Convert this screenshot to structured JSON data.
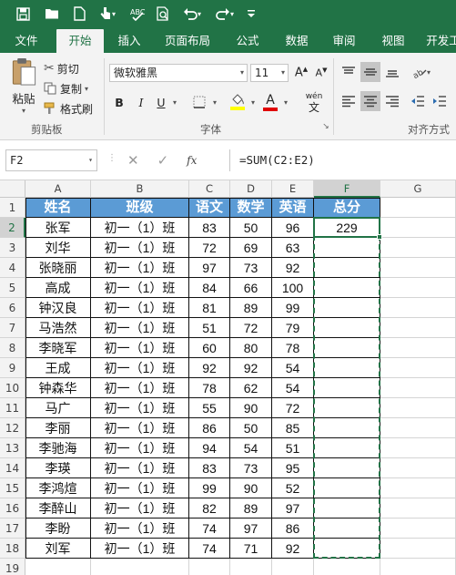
{
  "tabs": [
    "文件",
    "开始",
    "插入",
    "页面布局",
    "公式",
    "数据",
    "审阅",
    "视图",
    "开发工"
  ],
  "active_tab": "开始",
  "clipboard": {
    "paste": "粘贴",
    "cut": "剪切",
    "copy": "复制",
    "format_painter": "格式刷",
    "group_label": "剪贴板"
  },
  "font": {
    "name": "微软雅黑",
    "size": "11",
    "bold": "B",
    "italic": "I",
    "underline": "U",
    "wen": "wén",
    "wen_char": "文",
    "group_label": "字体"
  },
  "alignment": {
    "group_label": "对齐方式"
  },
  "formula_bar": {
    "name_box": "F2",
    "fx": "fx",
    "formula": "=SUM(C2:E2)"
  },
  "columns": [
    "A",
    "B",
    "C",
    "D",
    "E",
    "F",
    "G"
  ],
  "rows": [
    "1",
    "2",
    "3",
    "4",
    "5",
    "6",
    "7",
    "8",
    "9",
    "10",
    "11",
    "12",
    "13",
    "14",
    "15",
    "16",
    "17",
    "18",
    "19"
  ],
  "table": {
    "headers": [
      "姓名",
      "班级",
      "语文",
      "数学",
      "英语",
      "总分"
    ],
    "data": [
      [
        "张军",
        "初一（1）班",
        "83",
        "50",
        "96",
        "229"
      ],
      [
        "刘华",
        "初一（1）班",
        "72",
        "69",
        "63",
        ""
      ],
      [
        "张晓丽",
        "初一（1）班",
        "97",
        "73",
        "92",
        ""
      ],
      [
        "高成",
        "初一（1）班",
        "84",
        "66",
        "100",
        ""
      ],
      [
        "钟汉良",
        "初一（1）班",
        "81",
        "89",
        "99",
        ""
      ],
      [
        "马浩然",
        "初一（1）班",
        "51",
        "72",
        "79",
        ""
      ],
      [
        "李晓军",
        "初一（1）班",
        "60",
        "80",
        "78",
        ""
      ],
      [
        "王成",
        "初一（1）班",
        "92",
        "92",
        "54",
        ""
      ],
      [
        "钟森华",
        "初一（1）班",
        "78",
        "62",
        "54",
        ""
      ],
      [
        "马广",
        "初一（1）班",
        "55",
        "90",
        "72",
        ""
      ],
      [
        "李丽",
        "初一（1）班",
        "86",
        "50",
        "85",
        ""
      ],
      [
        "李驰海",
        "初一（1）班",
        "94",
        "54",
        "51",
        ""
      ],
      [
        "李瑛",
        "初一（1）班",
        "83",
        "73",
        "95",
        ""
      ],
      [
        "李鸿煊",
        "初一（1）班",
        "99",
        "90",
        "52",
        ""
      ],
      [
        "李醉山",
        "初一（1）班",
        "82",
        "89",
        "97",
        ""
      ],
      [
        "李盼",
        "初一（1）班",
        "74",
        "97",
        "86",
        ""
      ],
      [
        "刘军",
        "初一（1）班",
        "74",
        "71",
        "92",
        ""
      ]
    ]
  },
  "colors": {
    "excel_green": "#217346",
    "header_fill": "#5b9bd5",
    "header_text": "#ffffff"
  }
}
